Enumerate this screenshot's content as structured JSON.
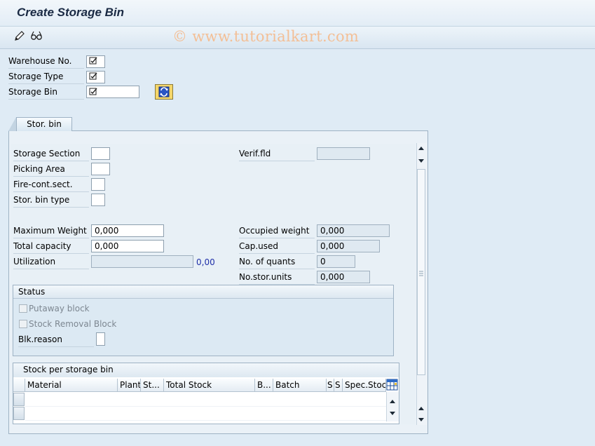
{
  "window": {
    "title": "Create Storage Bin"
  },
  "toolbar": {
    "icons": [
      "pencil-icon",
      "glasses-icon"
    ]
  },
  "watermark": "© www.tutorialkart.com",
  "header": {
    "warehouse_no": {
      "label": "Warehouse No.",
      "value": ""
    },
    "storage_type": {
      "label": "Storage Type",
      "value": ""
    },
    "storage_bin": {
      "label": "Storage Bin",
      "value": ""
    },
    "refresh_icon": "refresh-icon"
  },
  "tabs": [
    {
      "label": "Stor. bin",
      "active": true
    }
  ],
  "bin": {
    "storage_section": {
      "label": "Storage Section",
      "value": ""
    },
    "picking_area": {
      "label": "Picking Area",
      "value": ""
    },
    "fire_cont_sect": {
      "label": "Fire-cont.sect.",
      "value": ""
    },
    "stor_bin_type": {
      "label": "Stor. bin type",
      "value": ""
    },
    "verif_fld": {
      "label": "Verif.fld",
      "value": ""
    },
    "maximum_weight": {
      "label": "Maximum Weight",
      "value": "0,000"
    },
    "total_capacity": {
      "label": "Total capacity",
      "value": "0,000"
    },
    "utilization": {
      "label": "Utilization",
      "value": "",
      "percent": "0,00"
    },
    "occupied_weight": {
      "label": "Occupied weight",
      "value": "0,000"
    },
    "cap_used": {
      "label": "Cap.used",
      "value": "0,000"
    },
    "no_of_quants": {
      "label": "No. of quants",
      "value": "0"
    },
    "no_stor_units": {
      "label": "No.stor.units",
      "value": "0,000"
    }
  },
  "status": {
    "title": "Status",
    "putaway_block": {
      "label": "Putaway block",
      "checked": false
    },
    "stock_removal_block": {
      "label": "Stock Removal Block",
      "checked": false
    },
    "blk_reason": {
      "label": "Blk.reason",
      "value": ""
    }
  },
  "stock_table": {
    "title": "Stock per storage bin",
    "columns": [
      "Material",
      "Plant",
      "St...",
      "Total Stock",
      "B...",
      "Batch",
      "S",
      "S",
      "Spec.Stock"
    ],
    "rows": [],
    "settings_icon": "table-settings-icon"
  },
  "colors": {
    "background": "#dfebf5",
    "accent": "#1a2a44",
    "watermark": "#f3bf96"
  }
}
